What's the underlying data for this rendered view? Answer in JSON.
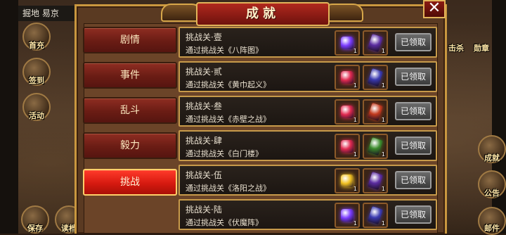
{
  "topbar": {
    "location": "掘地 易京"
  },
  "side_left": [
    {
      "label": "首充"
    },
    {
      "label": "签到"
    },
    {
      "label": "活动"
    },
    {
      "label": "保存"
    },
    {
      "label": "读档"
    }
  ],
  "side_right": [
    {
      "label": "击杀"
    },
    {
      "label": "勋章"
    },
    {
      "label": "成就"
    },
    {
      "label": "公告"
    },
    {
      "label": "邮件"
    }
  ],
  "panel": {
    "title": "成就",
    "close_label": "✕"
  },
  "tabs": [
    {
      "label": "剧情",
      "active": false
    },
    {
      "label": "事件",
      "active": false
    },
    {
      "label": "乱斗",
      "active": false
    },
    {
      "label": "毅力",
      "active": false
    },
    {
      "label": "挑战",
      "active": true
    }
  ],
  "achievements": [
    {
      "title": "挑战关·壹",
      "desc": "通过挑战关《八阵图》",
      "reward1": {
        "color": "#7b3cff",
        "qty": "1"
      },
      "reward2": {
        "color": "#5b2ca0",
        "qty": "1"
      },
      "button": "已领取"
    },
    {
      "title": "挑战关·贰",
      "desc": "通过挑战关《黄巾起义》",
      "reward1": {
        "color": "#e02a50",
        "qty": "1"
      },
      "reward2": {
        "color": "#3a3ab0",
        "qty": "1"
      },
      "button": "已领取"
    },
    {
      "title": "挑战关·叁",
      "desc": "通过挑战关《赤壁之战》",
      "reward1": {
        "color": "#e02a50",
        "qty": "1"
      },
      "reward2": {
        "color": "#c43a1e",
        "qty": "1"
      },
      "button": "已领取"
    },
    {
      "title": "挑战关·肆",
      "desc": "通过挑战关《白门楼》",
      "reward1": {
        "color": "#e02a50",
        "qty": "1"
      },
      "reward2": {
        "color": "#3a8a2a",
        "qty": "1"
      },
      "button": "已领取"
    },
    {
      "title": "挑战关·伍",
      "desc": "通过挑战关《洛阳之战》",
      "reward1": {
        "color": "#f0c020",
        "qty": "1"
      },
      "reward2": {
        "color": "#5b2ca0",
        "qty": "1"
      },
      "button": "已领取"
    },
    {
      "title": "挑战关·陆",
      "desc": "通过挑战关《伏魔阵》",
      "reward1": {
        "color": "#7b3cff",
        "qty": "1"
      },
      "reward2": {
        "color": "#3a3ab0",
        "qty": "1"
      },
      "button": "已领取"
    }
  ]
}
